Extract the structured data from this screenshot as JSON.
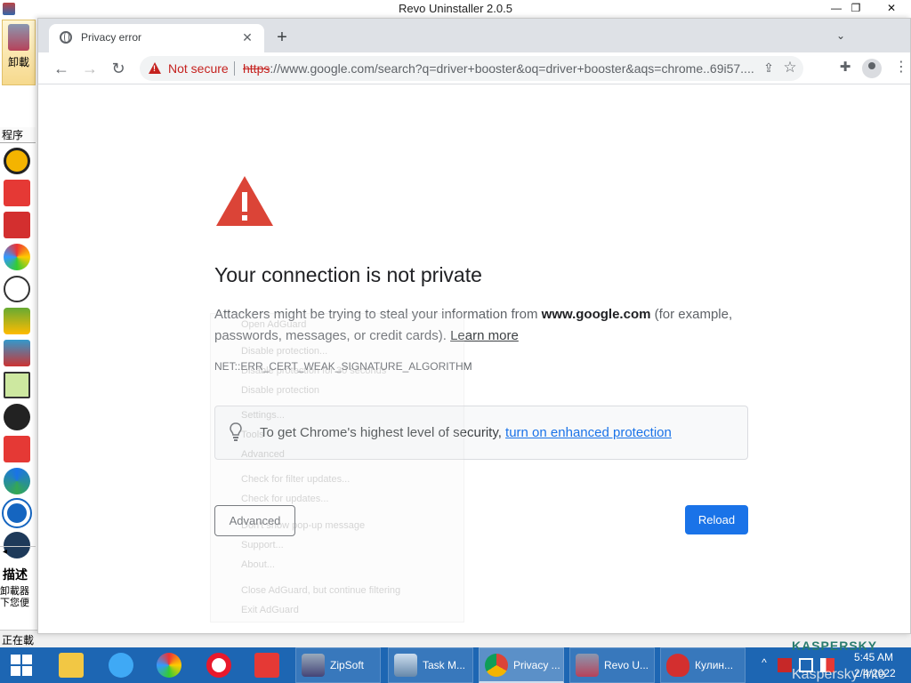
{
  "background_app": {
    "title": "Revo Uninstaller 2.0.5",
    "toolbar_label": "卸載",
    "column_header": "程序",
    "desc_title": "描述",
    "desc_line1": "卸載器",
    "desc_line2": "下您便",
    "status_text": "正在載"
  },
  "browser": {
    "tab_title": "Privacy error",
    "new_tab_label": "+",
    "address": {
      "security_label": "Not secure",
      "url_scheme": "https",
      "url_rest": "://www.google.com/search?q=driver+booster&oq=driver+booster&aqs=chrome..69i57...."
    }
  },
  "error_page": {
    "title": "Your connection is not private",
    "desc_prefix": "Attackers might be trying to steal your information from ",
    "desc_domain": "www.google.com",
    "desc_suffix": " (for example, passwords, messages, or credit cards). ",
    "learn_more": "Learn more",
    "error_code": "NET::ERR_CERT_WEAK_SIGNATURE_ALGORITHM",
    "enhanced_text": "To get Chrome's highest level of security, ",
    "enhanced_link": "turn on enhanced protection",
    "advanced_button": "Advanced",
    "reload_button": "Reload"
  },
  "ghost_menu": {
    "items": [
      "Open AdGuard",
      "Disable protection...",
      "Disable protection for 30 seconds",
      "Disable protection",
      "Settings...",
      "Tools",
      "Advanced",
      "Check for filter updates...",
      "Check for updates...",
      "Don't show pop-up message",
      "Support...",
      "About...",
      "Close AdGuard, but continue filtering",
      "Exit AdGuard"
    ]
  },
  "taskbar": {
    "tasks": [
      {
        "label": "ZipSoft",
        "icon": "zipsoft-icon"
      },
      {
        "label": "Task M...",
        "icon": "task-manager-icon"
      },
      {
        "label": "Privacy ...",
        "icon": "chrome-icon"
      },
      {
        "label": "Revo U...",
        "icon": "revo-icon"
      },
      {
        "label": "Кулин...",
        "icon": "pepper-icon"
      }
    ],
    "clock_time": "5:45 AM",
    "clock_date": "2/4/2022",
    "kaspersky_logo": "KASPERSKY",
    "kaspersky_text": "Kaspersky Inte"
  }
}
